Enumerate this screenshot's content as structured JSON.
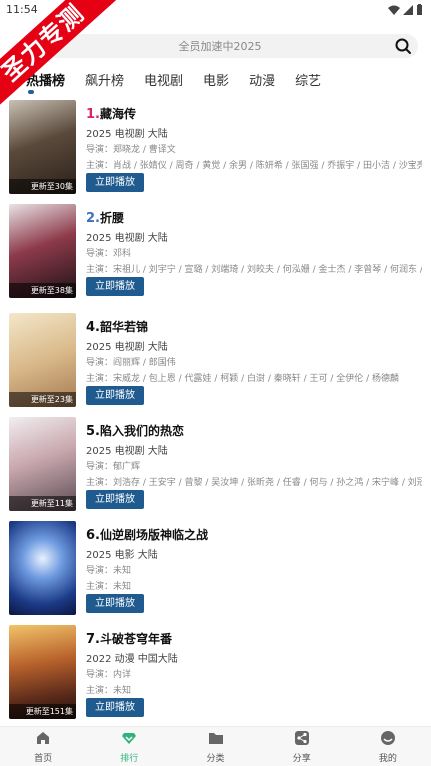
{
  "status": {
    "time": "11:54"
  },
  "banner": {
    "text": "圣力专测"
  },
  "search": {
    "placeholder": "全员加速中2025"
  },
  "tabs": [
    {
      "label": "热播榜"
    },
    {
      "label": "飙升榜"
    },
    {
      "label": "电视剧"
    },
    {
      "label": "电影"
    },
    {
      "label": "动漫"
    },
    {
      "label": "综艺"
    }
  ],
  "items": [
    {
      "rank": "1.",
      "title": "藏海传",
      "meta": "2025  电视剧  大陆",
      "director": "导演：郑晓龙 / 曹译文",
      "cast": "主演：肖战 / 张婧仪 / 周奇 / 黄觉 / 余男 / 陈妍希 / 张国强 / 乔振宇 / 田小洁 / 沙宝亮 / 张...",
      "update": "更新至30集",
      "play": "立即播放",
      "rank_color": "#d6246e"
    },
    {
      "rank": "2.",
      "title": "折腰",
      "meta": "2025  电视剧  大陆",
      "director": "导演：邓科",
      "cast": "主演：宋祖儿 / 刘宇宁 / 宣璐 / 刘端琦 / 刘皎夫 / 何泓姗 / 金士杰 / 李曾琴 / 何润东 / 王...",
      "update": "更新至38集",
      "play": "立即播放",
      "rank_color": "#3a6fc4"
    },
    {
      "rank": "4.",
      "title": "韶华若锦",
      "meta": "2025  电视剧  大陆",
      "director": "导演：阎丽辉 / 郎国伟",
      "cast": "主演：宋威龙 / 包上恩 / 代露娃 / 柯颖 / 白澍 / 秦晓轩 / 王可 / 全伊伦 / 杨德麟",
      "update": "更新至23集",
      "play": "立即播放",
      "rank_color": "#111111"
    },
    {
      "rank": "5.",
      "title": "陷入我们的热恋",
      "meta": "2025  电视剧  大陆",
      "director": "导演：郁广辉",
      "cast": "主演：刘浩存 / 王安宇 / 曾黎 / 吴汝坤 / 张昕尧 / 任睿 / 何与 / 孙之鸿 / 宋宁峰 / 刘冠成 / ...",
      "update": "更新至11集",
      "play": "立即播放",
      "rank_color": "#111111"
    },
    {
      "rank": "6.",
      "title": "仙逆剧场版神临之战",
      "meta": "2025  电影  大陆",
      "director": "导演：未知",
      "cast": "主演：未知",
      "update": "",
      "play": "立即播放",
      "rank_color": "#111111"
    },
    {
      "rank": "7.",
      "title": "斗破苍穹年番",
      "meta": "2022  动漫  中国大陆",
      "director": "导演：内详",
      "cast": "主演：未知",
      "update": "更新至151集",
      "play": "立即播放",
      "rank_color": "#111111"
    }
  ],
  "bottom_nav": [
    {
      "label": "首页",
      "icon": "home-icon"
    },
    {
      "label": "排行",
      "icon": "ranking-icon"
    },
    {
      "label": "分类",
      "icon": "folder-icon"
    },
    {
      "label": "分享",
      "icon": "share-icon"
    },
    {
      "label": "我的",
      "icon": "profile-icon"
    }
  ],
  "colors": {
    "accent": "#1f5b8f",
    "nav_active": "#2fb37a",
    "banner": "#e50013"
  }
}
